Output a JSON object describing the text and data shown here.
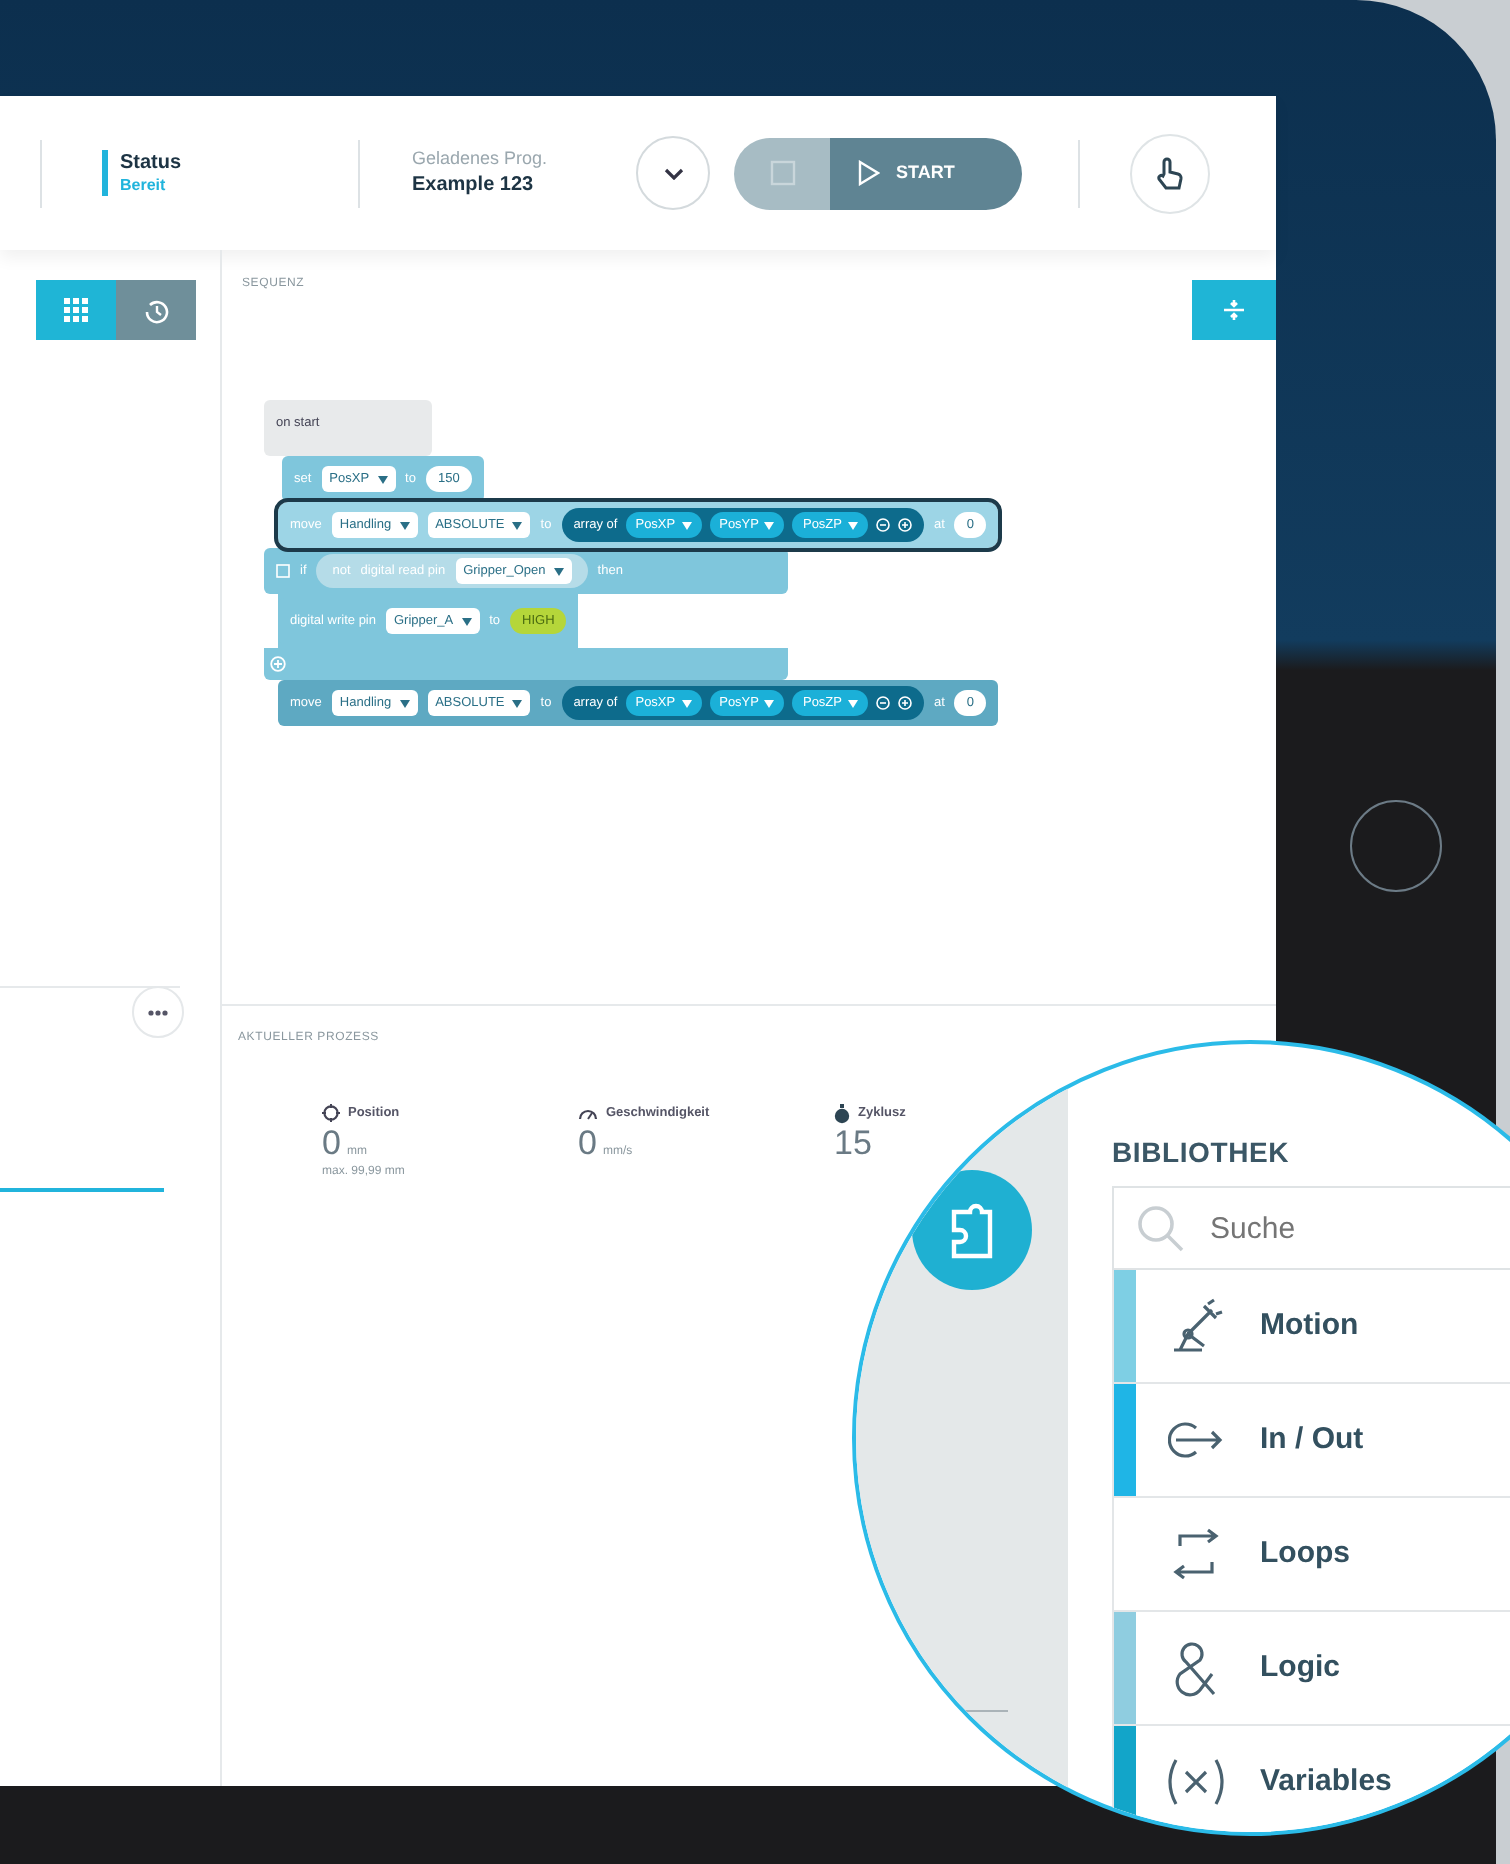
{
  "header": {
    "status": {
      "label": "Status",
      "value": "Bereit"
    },
    "program": {
      "label": "Geladenes Prog.",
      "value": "Example 123"
    },
    "start_button": {
      "label": "START"
    }
  },
  "left_panel": {
    "view_toggle": [
      {
        "kind": "grid",
        "selected": true
      },
      {
        "kind": "history",
        "selected": false
      }
    ]
  },
  "sequence": {
    "title": "SEQUENZ",
    "blocks": [
      {
        "kind": "hat",
        "parts": [
          {
            "kind": "label",
            "text": "on start"
          }
        ]
      },
      {
        "kind": "statement",
        "selected": false,
        "parts": [
          {
            "kind": "label",
            "text": "set"
          },
          {
            "kind": "dropdown",
            "text": "PosXP"
          },
          {
            "kind": "label",
            "text": "to"
          },
          {
            "kind": "value",
            "text": "150"
          }
        ]
      },
      {
        "kind": "statement",
        "selected": true,
        "parts": [
          {
            "kind": "label",
            "text": "move"
          },
          {
            "kind": "dropdown",
            "text": "Handling"
          },
          {
            "kind": "dropdown",
            "text": "ABSOLUTE"
          },
          {
            "kind": "label",
            "text": "to"
          },
          {
            "kind": "array",
            "text": "array of",
            "items": [
              "PosXP",
              "PosYP",
              "PosZP"
            ]
          },
          {
            "kind": "label",
            "text": "at"
          },
          {
            "kind": "value",
            "text": "0"
          }
        ]
      },
      {
        "kind": "if",
        "selected": false,
        "parts": [
          {
            "kind": "label",
            "text": "if"
          },
          {
            "kind": "condition",
            "parts": [
              {
                "kind": "label",
                "text": "not"
              },
              {
                "kind": "label",
                "text": "digital read pin"
              },
              {
                "kind": "dropdown",
                "text": "Gripper_Open"
              }
            ]
          },
          {
            "kind": "label",
            "text": "then"
          }
        ],
        "children": [
          {
            "kind": "statement",
            "selected": false,
            "parts": [
              {
                "kind": "label",
                "text": "digital write pin"
              },
              {
                "kind": "dropdown",
                "text": "Gripper_A"
              },
              {
                "kind": "label",
                "text": "to"
              },
              {
                "kind": "bool",
                "text": "HIGH"
              }
            ]
          }
        ]
      },
      {
        "kind": "statement",
        "selected": false,
        "parts": [
          {
            "kind": "label",
            "text": "move"
          },
          {
            "kind": "dropdown",
            "text": "Handling"
          },
          {
            "kind": "dropdown",
            "text": "ABSOLUTE"
          },
          {
            "kind": "label",
            "text": "to"
          },
          {
            "kind": "array",
            "text": "array of",
            "items": [
              "PosXP",
              "PosYP",
              "PosZP"
            ]
          },
          {
            "kind": "label",
            "text": "at"
          },
          {
            "kind": "value",
            "text": "0"
          }
        ]
      }
    ]
  },
  "process": {
    "title": "AKTUELLER PROZESS",
    "stats": [
      {
        "kind": "position",
        "label": "Position",
        "value": "0",
        "unit": "mm",
        "note": "max. 99,99 mm"
      },
      {
        "kind": "speed",
        "label": "Geschwindigkeit",
        "value": "0",
        "unit": "mm/s"
      },
      {
        "kind": "time",
        "label": "Zyklusz",
        "value": "15"
      }
    ]
  },
  "library": {
    "title": "BIBLIOTHEK",
    "search": {
      "placeholder": "Suche"
    },
    "categories": [
      {
        "kind": "motion",
        "label": "Motion",
        "color": "#7ecfe4"
      },
      {
        "kind": "inout",
        "label": "In / Out",
        "color": "#1fb5e6"
      },
      {
        "kind": "loops",
        "label": "Loops"
      },
      {
        "kind": "logic",
        "label": "Logic",
        "color": "#8fcde0"
      },
      {
        "kind": "variables",
        "label": "Variables",
        "color": "#12a5c9"
      }
    ]
  }
}
